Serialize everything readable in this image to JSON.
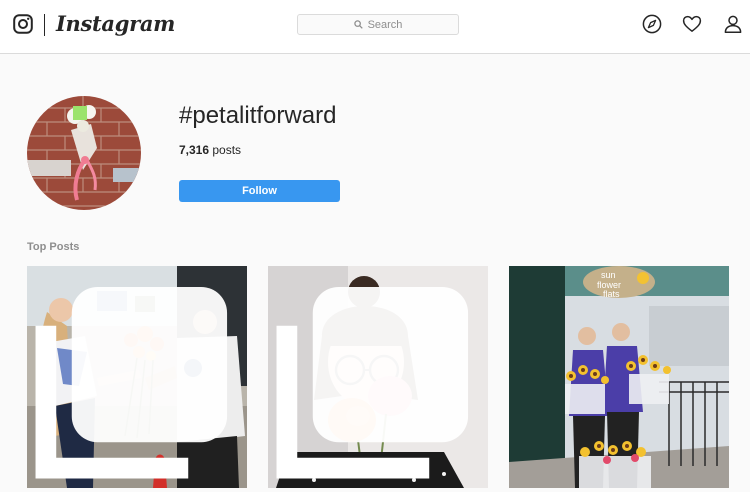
{
  "header": {
    "brand": "Instagram",
    "search_placeholder": "Search",
    "icons": [
      "instagram-glyph-icon",
      "search-icon",
      "compass-icon",
      "heart-icon",
      "user-icon"
    ]
  },
  "profile": {
    "hashtag": "#petalitforward",
    "post_count": "7,316",
    "post_count_label": "posts",
    "follow_label": "Follow"
  },
  "top_posts": {
    "label": "Top Posts",
    "posts": [
      {
        "alt": "Girl handing orange roses to a police officer",
        "multi": true
      },
      {
        "alt": "Woman with glasses smelling pink and orange roses",
        "multi": true
      },
      {
        "alt": "Two women holding buckets of sunflowers outside Sun Flower Flats",
        "multi": false
      }
    ]
  },
  "store_sign": [
    "sun",
    "flower",
    "flats"
  ],
  "colors": {
    "accent": "#3897f0",
    "text": "#262626",
    "muted": "#8e8e8e",
    "border": "#dbdbdb",
    "background": "#fafafa"
  }
}
